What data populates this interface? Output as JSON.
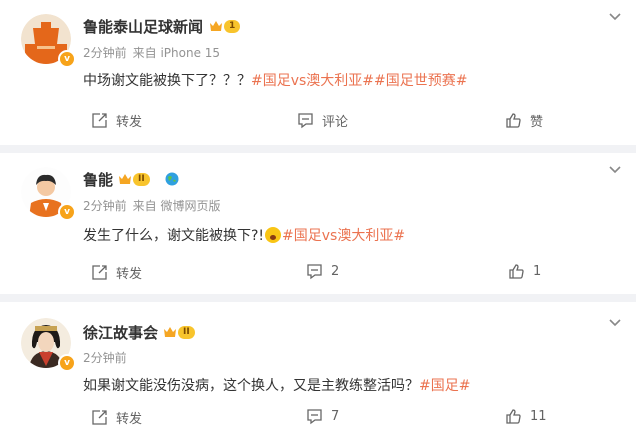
{
  "posts": [
    {
      "author": "鲁能泰山足球新闻",
      "level": "1",
      "verified_mark": "v",
      "time": "2分钟前",
      "source": "来自 iPhone 15",
      "text_before": "中场谢文能被换下了？？？",
      "emoji": "",
      "tags": [
        "#国足vs澳大利亚#",
        "#国足世预赛#"
      ],
      "actions": {
        "repost": "转发",
        "comment": "评论",
        "like": "赞"
      }
    },
    {
      "author": "鲁能",
      "level": "II",
      "verified_mark": "v",
      "time": "2分钟前",
      "source": "来自 微博网页版",
      "text_before": "发生了什么，谢文能被换下?!",
      "emoji": "surprised-emoji",
      "tags": [
        "#国足vs澳大利亚#"
      ],
      "actions": {
        "repost": "转发",
        "comment": "2",
        "like": "1"
      }
    },
    {
      "author": "徐江故事会",
      "level": "II",
      "verified_mark": "v",
      "time": "2分钟前",
      "source": "",
      "text_before": "如果谢文能没伤没病，这个换人，又是主教练整活吗？",
      "emoji": "",
      "tags": [
        "#国足#"
      ],
      "actions": {
        "repost": "转发",
        "comment": "7",
        "like": "11"
      }
    }
  ],
  "colors": {
    "tag": "#eb7350",
    "background": "#f1f2f5",
    "crown": "#f8c42c"
  }
}
